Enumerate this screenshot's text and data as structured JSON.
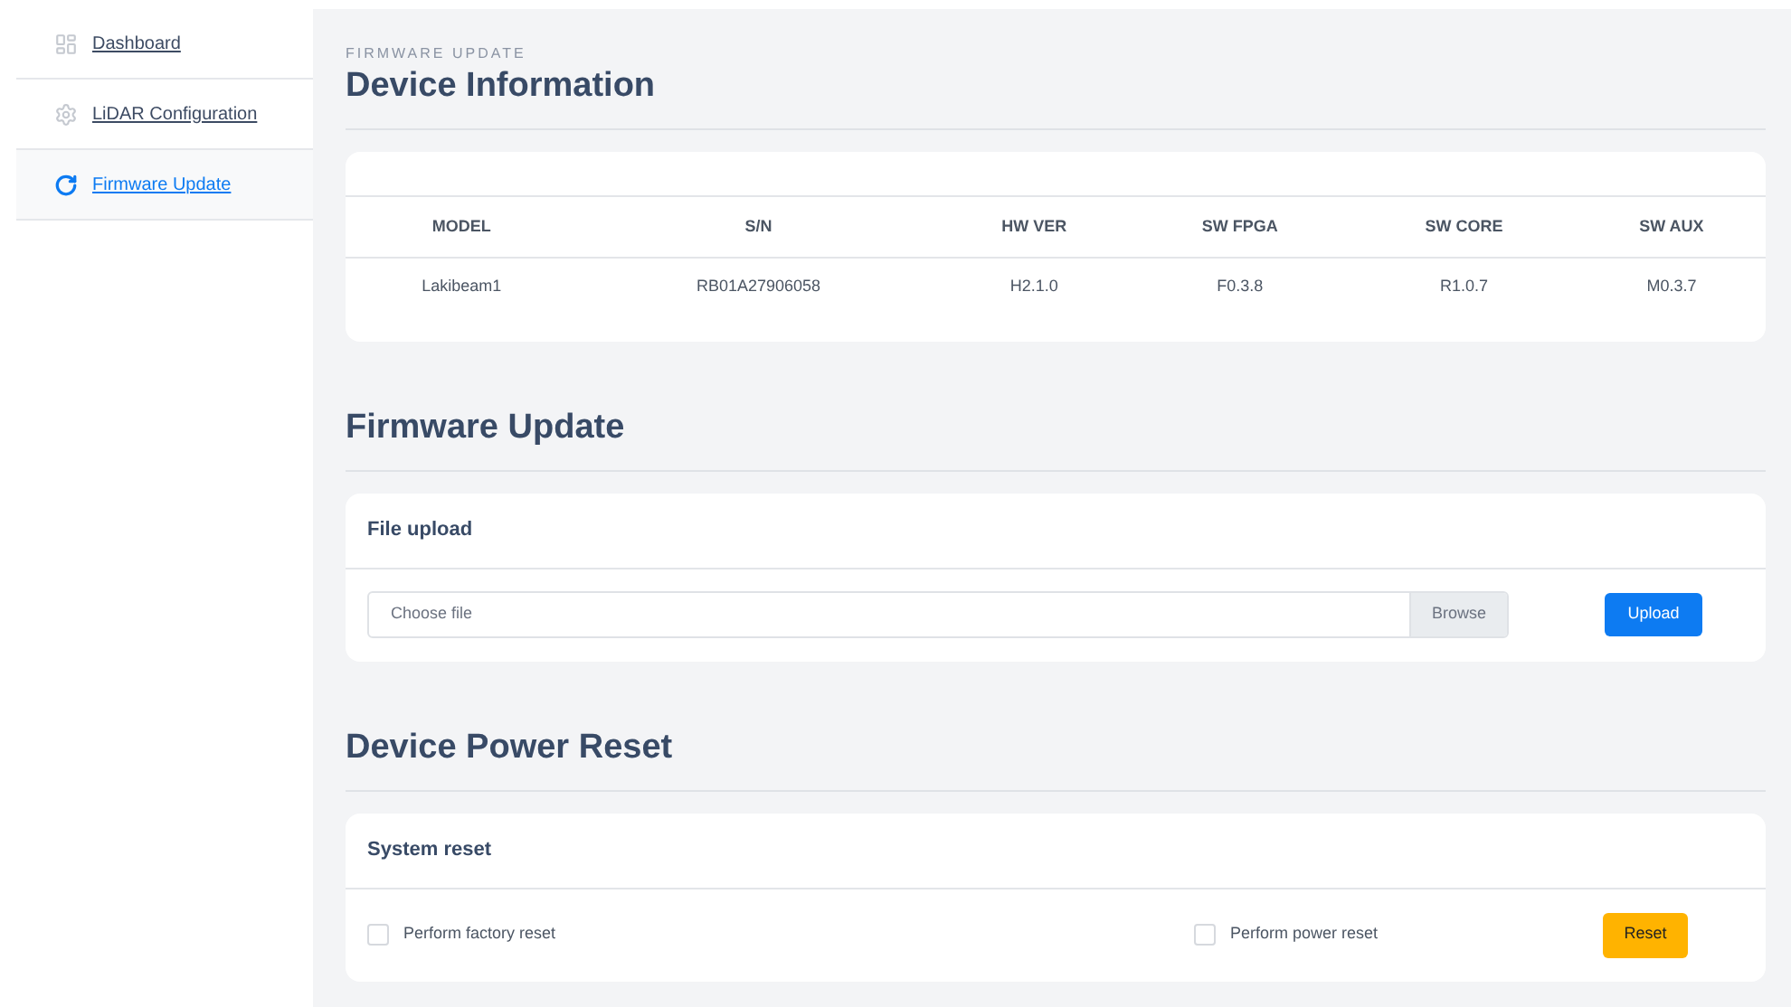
{
  "sidebar": {
    "items": [
      {
        "label": "Dashboard",
        "kind": "dashboard",
        "selected": false
      },
      {
        "label": "LiDAR Configuration",
        "kind": "settings",
        "selected": false
      },
      {
        "label": "Firmware Update",
        "kind": "update",
        "selected": true
      }
    ]
  },
  "breadcrumb": "FIRMWARE UPDATE",
  "device_info": {
    "title": "Device Information",
    "table": {
      "columns": [
        "MODEL",
        "S/N",
        "HW VER",
        "SW FPGA",
        "SW CORE",
        "SW AUX"
      ],
      "rows": [
        [
          "Lakibeam1",
          "RB01A27906058",
          "H2.1.0",
          "F0.3.8",
          "R1.0.7",
          "M0.3.7"
        ]
      ]
    }
  },
  "firmware_update": {
    "title": "Firmware Update",
    "card_title": "File upload",
    "file_field": {
      "placeholder": "Choose file"
    },
    "browse_button": "Browse",
    "upload_button": "Upload"
  },
  "power_reset": {
    "title": "Device Power Reset",
    "card_title": "System reset",
    "options": [
      {
        "label": "Perform factory reset",
        "checked": false
      },
      {
        "label": "Perform power reset",
        "checked": false
      }
    ],
    "reset_button": "Reset"
  }
}
